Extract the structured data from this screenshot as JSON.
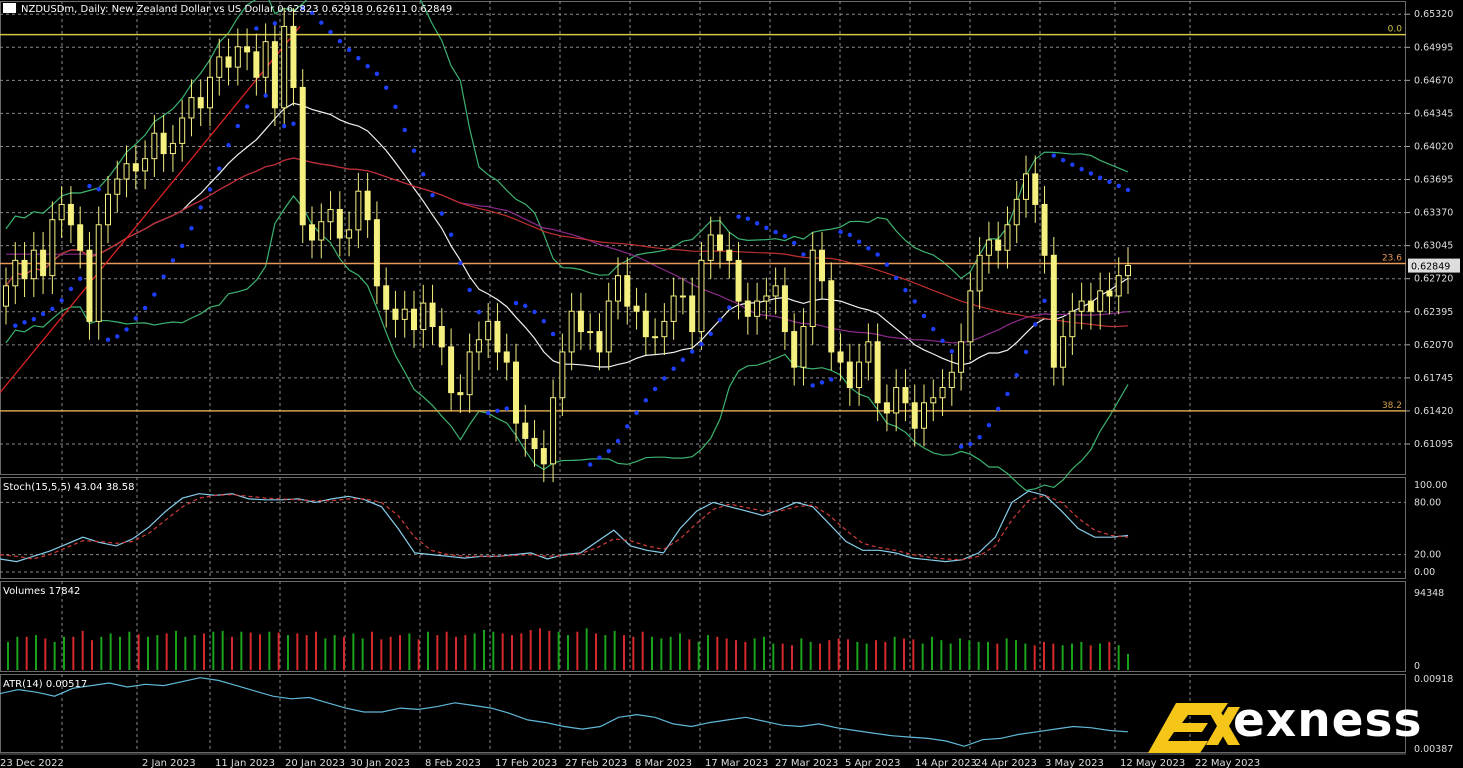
{
  "chart_data": [
    {
      "name": "price",
      "type": "candlestick",
      "title": "NZDUSDm, Daily:  New Zealand Dollar vs US Dollar  0.62823 0.62918 0.62611 0.62849",
      "ylim": [
        0.608,
        0.6545
      ],
      "y_ticks": [
        "0.65320",
        "0.64995",
        "0.64670",
        "0.64345",
        "0.64020",
        "0.63695",
        "0.63370",
        "0.63045",
        "0.62720",
        "0.62395",
        "0.62070",
        "0.61745",
        "0.61420",
        "0.61095"
      ],
      "last_price_label": "0.62849",
      "x_labels": [
        "23 Dec 2022",
        "2 Jan 2023",
        "11 Jan 2023",
        "20 Jan 2023",
        "30 Jan 2023",
        "8 Feb 2023",
        "17 Feb 2023",
        "27 Feb 2023",
        "8 Mar 2023",
        "17 Mar 2023",
        "27 Mar 2023",
        "5 Apr 2023",
        "14 Apr 2023",
        "24 Apr 2023",
        "3 May 2023",
        "12 May 2023",
        "22 May 2023"
      ],
      "fib_levels": [
        {
          "label": "0.0",
          "price": 0.6512,
          "color": "#d4c44a"
        },
        {
          "label": "23.6",
          "price": 0.6287,
          "color": "#e89a5a"
        },
        {
          "label": "38.2",
          "price": 0.6142,
          "color": "#d4a04a"
        }
      ],
      "closes": [
        0.6265,
        0.629,
        0.6272,
        0.63,
        0.6275,
        0.633,
        0.6345,
        0.6325,
        0.63,
        0.623,
        0.6325,
        0.6355,
        0.637,
        0.6385,
        0.6378,
        0.639,
        0.6415,
        0.6395,
        0.6405,
        0.643,
        0.645,
        0.644,
        0.647,
        0.649,
        0.648,
        0.65,
        0.6495,
        0.647,
        0.6505,
        0.644,
        0.652,
        0.646,
        0.6325,
        0.631,
        0.6328,
        0.634,
        0.6312,
        0.632,
        0.6358,
        0.633,
        0.6265,
        0.6242,
        0.6232,
        0.6242,
        0.6222,
        0.6248,
        0.6225,
        0.6205,
        0.616,
        0.6158,
        0.62,
        0.6212,
        0.623,
        0.62,
        0.619,
        0.613,
        0.6115,
        0.6105,
        0.609,
        0.6155,
        0.62,
        0.624,
        0.622,
        0.622,
        0.62,
        0.625,
        0.6275,
        0.6245,
        0.624,
        0.6215,
        0.6215,
        0.623,
        0.6255,
        0.6255,
        0.622,
        0.629,
        0.6315,
        0.63,
        0.629,
        0.625,
        0.6235,
        0.625,
        0.6255,
        0.6265,
        0.622,
        0.6185,
        0.6225,
        0.63,
        0.627,
        0.62,
        0.619,
        0.6165,
        0.619,
        0.621,
        0.615,
        0.614,
        0.6165,
        0.615,
        0.6125,
        0.615,
        0.6155,
        0.6165,
        0.618,
        0.621,
        0.626,
        0.6295,
        0.631,
        0.63,
        0.6325,
        0.635,
        0.6375,
        0.6345,
        0.6295,
        0.6185,
        0.6215,
        0.624,
        0.625,
        0.624,
        0.626,
        0.6255,
        0.6275,
        0.6285
      ],
      "indicators": [
        "Bollinger Bands",
        "Moving Averages",
        "Parabolic SAR"
      ]
    },
    {
      "name": "stochastic",
      "type": "line",
      "title": "Stoch(15,5,5) 43.04 38.58",
      "ylim": [
        0,
        100
      ],
      "y_ticks": [
        "100.00",
        "80.00",
        "20.00",
        "0.00"
      ],
      "series": [
        {
          "color": "#87ceeb",
          "values": [
            15,
            12,
            18,
            24,
            32,
            40,
            34,
            30,
            38,
            52,
            70,
            85,
            90,
            88,
            90,
            84,
            83,
            83,
            84,
            80,
            84,
            87,
            83,
            75,
            50,
            22,
            20,
            18,
            16,
            18,
            18,
            20,
            22,
            15,
            20,
            22,
            35,
            48,
            30,
            25,
            22,
            50,
            70,
            80,
            75,
            70,
            65,
            72,
            80,
            75,
            55,
            35,
            25,
            25,
            22,
            16,
            14,
            12,
            14,
            22,
            40,
            80,
            93,
            88,
            70,
            50,
            40,
            40,
            42
          ]
        },
        {
          "color": "#d23c3c",
          "values": [
            20,
            18,
            15,
            20,
            28,
            36,
            35,
            33,
            35,
            45,
            60,
            75,
            85,
            88,
            89,
            87,
            85,
            84,
            83,
            82,
            82,
            84,
            84,
            80,
            65,
            40,
            25,
            20,
            18,
            18,
            18,
            19,
            20,
            18,
            19,
            21,
            28,
            38,
            36,
            30,
            26,
            38,
            56,
            72,
            78,
            74,
            70,
            70,
            75,
            77,
            65,
            48,
            33,
            28,
            25,
            20,
            17,
            15,
            14,
            18,
            30,
            60,
            82,
            88,
            80,
            62,
            48,
            42,
            40
          ]
        }
      ]
    },
    {
      "name": "volumes",
      "type": "bar",
      "title": "Volumes 17842",
      "ylim": [
        0,
        94348
      ],
      "y_ticks": [
        "94348",
        "0"
      ],
      "values": [
        32000,
        38000,
        38000,
        40000,
        36000,
        32000,
        38000,
        38000,
        45000,
        34000,
        38000,
        42000,
        38000,
        44000,
        41000,
        38000,
        40000,
        42000,
        45000,
        38000,
        40000,
        42000,
        44000,
        45000,
        38000,
        44000,
        43000,
        41000,
        44000,
        43000,
        40000,
        42000,
        40000,
        44000,
        36000,
        40000,
        38000,
        42000,
        36000,
        44000,
        35000,
        38000,
        40000,
        42000,
        35000,
        44000,
        40000,
        44000,
        38000,
        40000,
        42000,
        46000,
        44000,
        42000,
        40000,
        42000,
        46000,
        48000,
        45000,
        44000,
        40000,
        44000,
        48000,
        42000,
        40000,
        45000,
        40000,
        38000,
        44000,
        38000,
        36000,
        38000,
        42000,
        35000,
        32000,
        40000,
        38000,
        36000,
        34000,
        32000,
        36000,
        38000,
        30000,
        30000,
        28000,
        36000,
        32000,
        30000,
        34000,
        36000,
        35000,
        32000,
        30000,
        34000,
        32000,
        38000,
        36000,
        35000,
        30000,
        38000,
        34000,
        30000,
        36000,
        34000,
        32000,
        32000,
        30000,
        36000,
        34000,
        30000,
        28000,
        32000,
        30000,
        28000,
        30000,
        32000,
        28000,
        30000,
        32000,
        28000,
        17842
      ],
      "up_color": "#1aa31a",
      "down_color": "#d42a2a"
    },
    {
      "name": "atr",
      "type": "line",
      "title": "ATR(14) 0.00517",
      "ylim": [
        0.00387,
        0.00918
      ],
      "y_ticks": [
        "0.00918",
        "0.00387"
      ],
      "values": [
        0.008,
        0.0083,
        0.0081,
        0.0078,
        0.0084,
        0.0086,
        0.0088,
        0.0085,
        0.0087,
        0.0086,
        0.0089,
        0.0092,
        0.009,
        0.0086,
        0.0082,
        0.0078,
        0.0076,
        0.0077,
        0.0073,
        0.0069,
        0.0066,
        0.0066,
        0.0069,
        0.0068,
        0.007,
        0.0073,
        0.0071,
        0.0069,
        0.0065,
        0.006,
        0.0058,
        0.0055,
        0.0053,
        0.0055,
        0.0062,
        0.0064,
        0.0062,
        0.0057,
        0.0055,
        0.0058,
        0.006,
        0.0062,
        0.0059,
        0.0056,
        0.0055,
        0.0057,
        0.0054,
        0.0052,
        0.005,
        0.0048,
        0.0047,
        0.0046,
        0.0044,
        0.004,
        0.0045,
        0.0046,
        0.0049,
        0.0051,
        0.0053,
        0.0055,
        0.0054,
        0.0052,
        0.0051
      ]
    }
  ],
  "logo": {
    "text": "exness",
    "color": "#f5c518"
  }
}
